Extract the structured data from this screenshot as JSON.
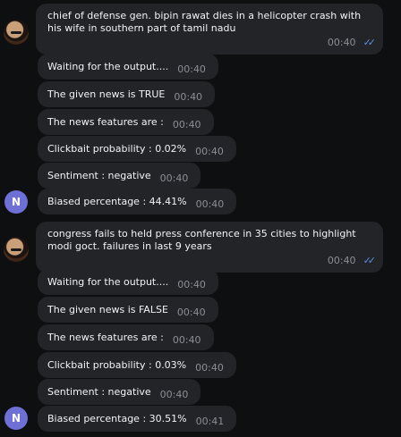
{
  "thread1": {
    "message": "chief of defense gen. bipin rawat dies in a helicopter crash with his wife in southern part of tamil nadu",
    "time": "00:40",
    "replies": [
      {
        "text": "Waiting for the output....",
        "time": "00:40"
      },
      {
        "text": "The given news is TRUE",
        "time": "00:40"
      },
      {
        "text": "The news features are :",
        "time": "00:40"
      },
      {
        "text": "Clickbait probability : 0.02%",
        "time": "00:40"
      },
      {
        "text": "Sentiment : negative",
        "time": "00:40"
      },
      {
        "text": "Biased percentage : 44.41%",
        "time": "00:40"
      }
    ]
  },
  "thread2": {
    "message": "congress fails to held press conference in 35 cities to highlight modi goct. failures in last 9 years",
    "time": "00:40",
    "replies": [
      {
        "text": "Waiting for the output....",
        "time": "00:40"
      },
      {
        "text": "The given news is FALSE",
        "time": "00:40"
      },
      {
        "text": "The news features are :",
        "time": "00:40"
      },
      {
        "text": "Clickbait probability : 0.03%",
        "time": "00:40"
      },
      {
        "text": "Sentiment : negative",
        "time": "00:40"
      },
      {
        "text": "Biased percentage : 30.51%",
        "time": "00:41"
      }
    ]
  },
  "bot_avatar_letter": "N",
  "colors": {
    "background": "#0e0f11",
    "bubble": "#232428",
    "avatar": "#6f70d6",
    "read_check": "#5a8fe0"
  }
}
